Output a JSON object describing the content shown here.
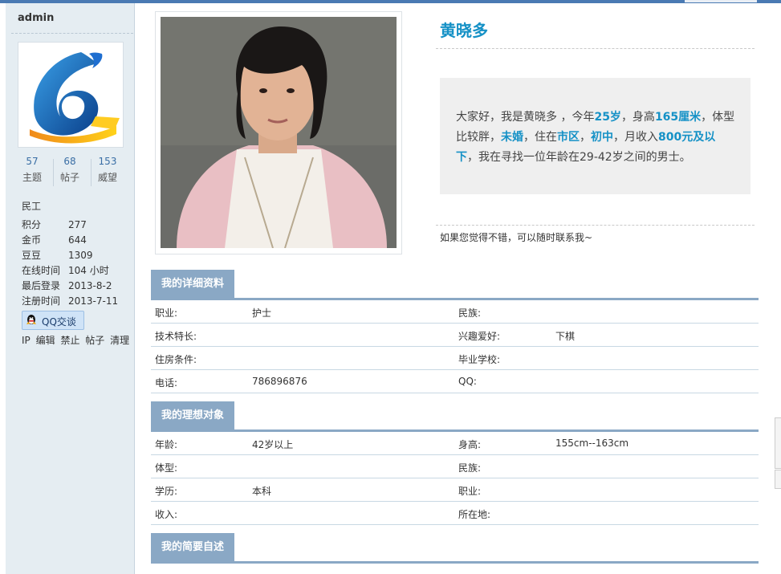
{
  "sidebar": {
    "username": "admin",
    "stats": [
      {
        "num": "57",
        "label": "主题"
      },
      {
        "num": "68",
        "label": "帖子"
      },
      {
        "num": "153",
        "label": "威望"
      }
    ],
    "rank": "民工",
    "info": [
      {
        "k": "积分",
        "v": "277"
      },
      {
        "k": "金币",
        "v": "644"
      },
      {
        "k": "豆豆",
        "v": "1309"
      },
      {
        "k": "在线时间",
        "v": "104 小时"
      },
      {
        "k": "最后登录",
        "v": "2013-8-2"
      },
      {
        "k": "注册时间",
        "v": "2013-7-11"
      }
    ],
    "qq_button": "QQ交谈",
    "links": [
      "IP",
      "编辑",
      "禁止",
      "帖子",
      "清理"
    ]
  },
  "profile": {
    "name": "黄晓多",
    "intro": {
      "p1": "大家好，我是黄晓多 ，今年",
      "age": "25岁",
      "p2": "，身高",
      "height": "165厘米",
      "p3": "，体型比较胖，",
      "marital": "未婚",
      "p4": "，住在",
      "area": "市区",
      "p5": "，",
      "edu": "初中",
      "p6": "，月收入",
      "income": "800元及以下",
      "p7": "，我在寻找一位年龄在29-42岁之间的男士。"
    },
    "contact_note": "如果您觉得不错，可以随时联系我~"
  },
  "sections": [
    {
      "title": "我的详细资料",
      "rows": [
        [
          "职业:",
          "护士",
          "民族:",
          ""
        ],
        [
          "技术特长:",
          "",
          "兴趣爱好:",
          "下棋"
        ],
        [
          "住房条件:",
          "",
          "毕业学校:",
          ""
        ],
        [
          "电话:",
          "786896876",
          "QQ:",
          ""
        ]
      ]
    },
    {
      "title": "我的理想对象",
      "rows": [
        [
          "年龄:",
          "42岁以上",
          "身高:",
          "155cm--163cm"
        ],
        [
          "体型:",
          "",
          "民族:",
          ""
        ],
        [
          "学历:",
          "本科",
          "职业:",
          ""
        ],
        [
          "收入:",
          "",
          "所在地:",
          ""
        ]
      ]
    },
    {
      "title": "我的简要自述",
      "rows": []
    }
  ],
  "colors": {
    "accent": "#1591c6",
    "section_header": "#8aa8c5",
    "sidebar_bg": "#e5edf2"
  }
}
